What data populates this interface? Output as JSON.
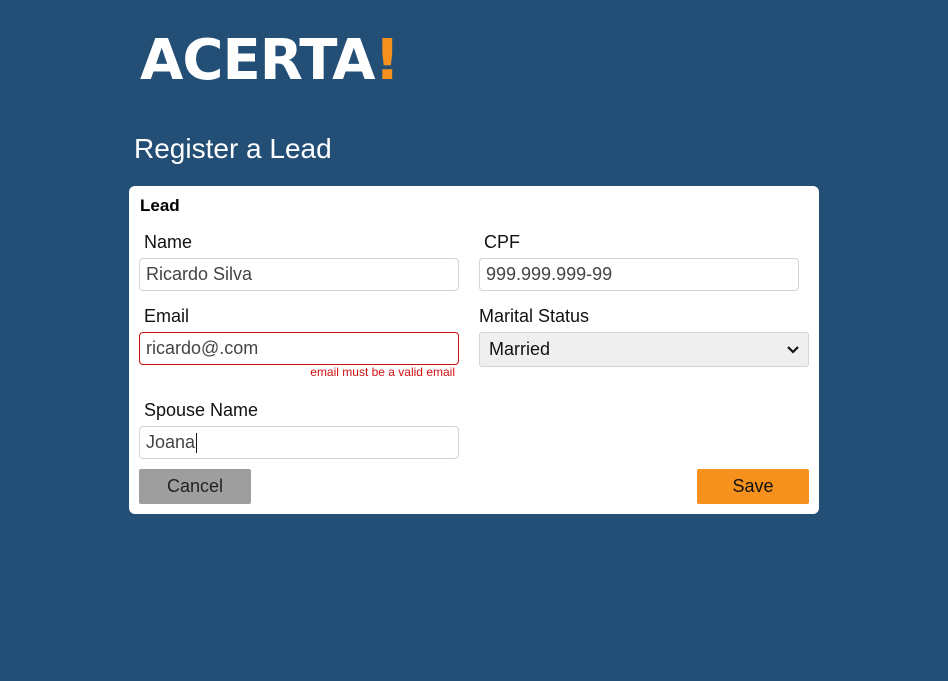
{
  "brand": {
    "logo_text": "ACERTA",
    "logo_mark": "!",
    "accent_color": "#f7911e",
    "background_color": "#234e75"
  },
  "page": {
    "title": "Register a Lead"
  },
  "form": {
    "section_title": "Lead",
    "name": {
      "label": "Name",
      "value": "Ricardo Silva"
    },
    "cpf": {
      "label": "CPF",
      "placeholder": "999.999.999-99",
      "value": ""
    },
    "email": {
      "label": "Email",
      "value": "ricardo@.com",
      "error": "email must be a valid email",
      "error_color": "#d01010"
    },
    "marital_status": {
      "label": "Marital Status",
      "selected": "Married",
      "icon": "chevron-down-icon"
    },
    "spouse_name": {
      "label": "Spouse Name",
      "value": "Joana"
    },
    "actions": {
      "cancel_label": "Cancel",
      "save_label": "Save"
    }
  }
}
